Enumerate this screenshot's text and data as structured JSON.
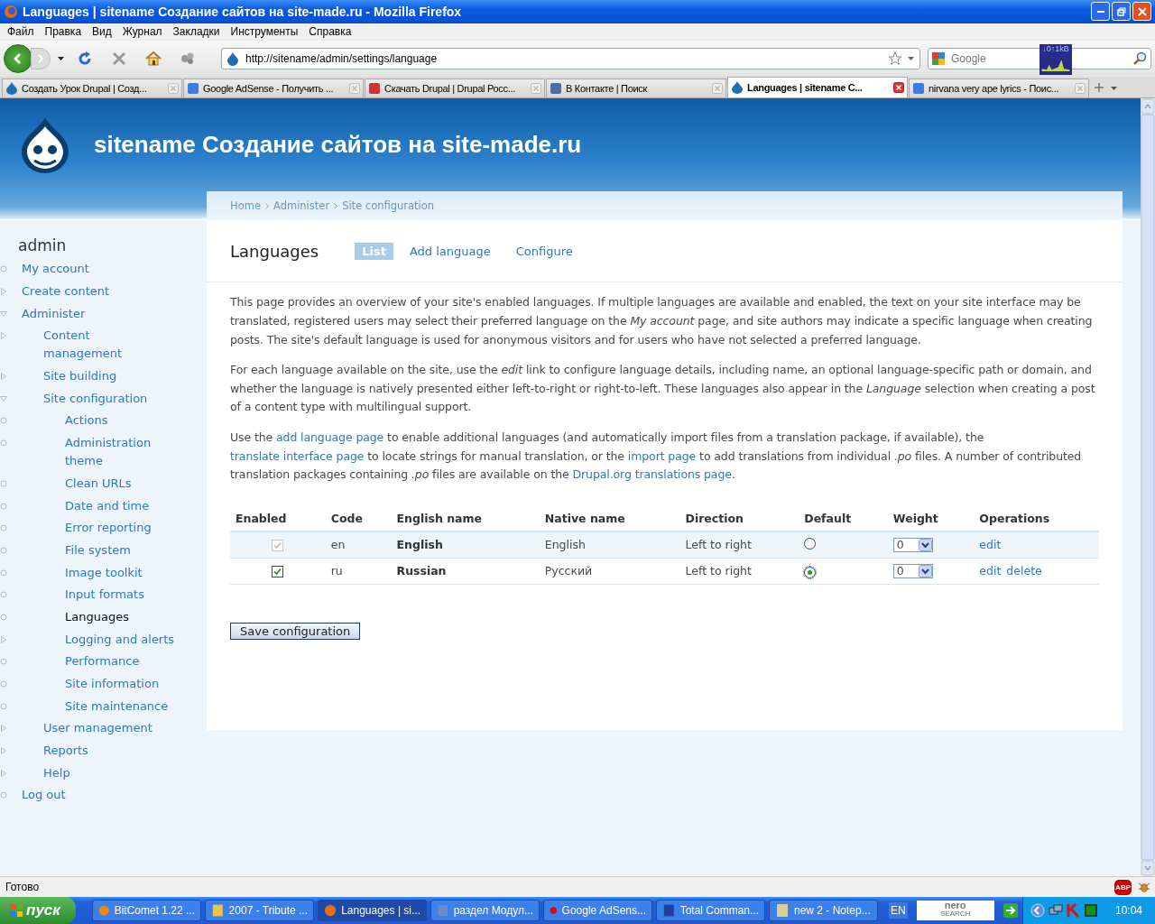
{
  "window": {
    "title": "Languages | sitename Создание сайтов на site-made.ru - Mozilla Firefox"
  },
  "menu": [
    "Файл",
    "Правка",
    "Вид",
    "Журнал",
    "Закладки",
    "Инструменты",
    "Справка"
  ],
  "address": {
    "url": "http://sitename/admin/settings/language"
  },
  "search": {
    "placeholder": "Google"
  },
  "net_meter": {
    "reading": "↓0↑1kB"
  },
  "tabs": [
    {
      "label": "Создать Урок Drupal | Созд...",
      "selected": false
    },
    {
      "label": "Google AdSense - Получить ...",
      "selected": false
    },
    {
      "label": "Скачать Drupal | Drupal Росс...",
      "selected": false
    },
    {
      "label": "В Контакте | Поиск",
      "selected": false
    },
    {
      "label": "Languages | sitename C...",
      "selected": true
    },
    {
      "label": "nirvana very ape lyrics - Поис...",
      "selected": false
    }
  ],
  "site": {
    "name": "sitename Создание сайтов на site-made.ru"
  },
  "sidebar": {
    "title": "admin",
    "items": [
      {
        "label": "My account",
        "kind": "leaf",
        "selected": false
      },
      {
        "label": "Create content",
        "kind": "branch",
        "expanded": false,
        "selected": false
      },
      {
        "label": "Administer",
        "kind": "branch",
        "expanded": true,
        "selected": false,
        "children": [
          {
            "label": "Content management",
            "kind": "branch",
            "expanded": false,
            "selected": false
          },
          {
            "label": "Site building",
            "kind": "branch",
            "expanded": false,
            "selected": false
          },
          {
            "label": "Site configuration",
            "kind": "branch",
            "expanded": true,
            "selected": false,
            "children": [
              {
                "label": "Actions",
                "kind": "leaf",
                "selected": false
              },
              {
                "label": "Administration theme",
                "kind": "leaf",
                "selected": false
              },
              {
                "label": "Clean URLs",
                "kind": "leaf",
                "selected": false
              },
              {
                "label": "Date and time",
                "kind": "leaf",
                "selected": false
              },
              {
                "label": "Error reporting",
                "kind": "leaf",
                "selected": false
              },
              {
                "label": "File system",
                "kind": "leaf",
                "selected": false
              },
              {
                "label": "Image toolkit",
                "kind": "leaf",
                "selected": false
              },
              {
                "label": "Input formats",
                "kind": "leaf",
                "selected": false
              },
              {
                "label": "Languages",
                "kind": "leaf",
                "selected": true
              },
              {
                "label": "Logging and alerts",
                "kind": "branch",
                "expanded": false,
                "selected": false
              },
              {
                "label": "Performance",
                "kind": "leaf",
                "selected": false
              },
              {
                "label": "Site information",
                "kind": "leaf",
                "selected": false
              },
              {
                "label": "Site maintenance",
                "kind": "leaf",
                "selected": false
              }
            ]
          },
          {
            "label": "User management",
            "kind": "branch",
            "expanded": false,
            "selected": false
          },
          {
            "label": "Reports",
            "kind": "branch",
            "expanded": false,
            "selected": false
          },
          {
            "label": "Help",
            "kind": "branch",
            "expanded": false,
            "selected": false
          }
        ]
      },
      {
        "label": "Log out",
        "kind": "leaf",
        "selected": false
      }
    ]
  },
  "breadcrumb": [
    "Home",
    "Administer",
    "Site configuration"
  ],
  "page": {
    "title": "Languages",
    "tabs": [
      {
        "label": "List",
        "selected": true
      },
      {
        "label": "Add language",
        "selected": false
      },
      {
        "label": "Configure",
        "selected": false
      }
    ]
  },
  "paragraphs": [
    [
      {
        "text": "This page provides an overview of your site's enabled languages. If multiple languages are available and enabled, the text on your site interface may be translated, registered users may select their preferred language on the *My account* page, and site authors may indicate a specific language when creating posts. The site's default language is used for anonymous visitors and for users who have not selected a preferred language.",
        "kind": "text"
      }
    ],
    [
      {
        "text": "For each language available on the site, use the *edit* link to configure language details, including name, an optional language-specific path or domain, and whether the language is natively presented either left-to-right or right-to-left. These languages also appear in the *Language* selection when creating a post of a content type with multilingual support.",
        "kind": "text"
      }
    ],
    [
      {
        "text": "Use the ",
        "kind": "text"
      },
      {
        "text": "add language page",
        "kind": "link"
      },
      {
        "text": " to enable additional languages (and automatically import files from a translation package, if available), the ",
        "kind": "text"
      },
      {
        "text": "translate interface page",
        "kind": "link"
      },
      {
        "text": " to locate strings for manual translation, or the ",
        "kind": "text"
      },
      {
        "text": "import page",
        "kind": "link"
      },
      {
        "text": " to add translations from individual *.po* files. A number of contributed translation packages containing *.po* files are available on the ",
        "kind": "text"
      },
      {
        "text": "Drupal.org translations page",
        "kind": "link"
      },
      {
        "text": ".",
        "kind": "text"
      }
    ]
  ],
  "languages": {
    "columns": [
      "Enabled",
      "Code",
      "English name",
      "Native name",
      "Direction",
      "Default",
      "Weight",
      "Operations"
    ],
    "rows": [
      {
        "enabled": true,
        "disabled": true,
        "code": "en",
        "english_name": "English",
        "native_name": "English",
        "direction": "Left to right",
        "default": false,
        "weight": "0",
        "operations": [
          "edit"
        ]
      },
      {
        "enabled": true,
        "disabled": false,
        "code": "ru",
        "english_name": "Russian",
        "native_name": "Русский",
        "direction": "Left to right",
        "default": true,
        "weight": "0",
        "operations": [
          "edit",
          "delete"
        ]
      }
    ]
  },
  "save_button": "Save configuration",
  "status_bar": {
    "text": "Готово",
    "abp": "ABP"
  },
  "taskbar": {
    "start": "пуск",
    "items": [
      {
        "label": "BitComet 1.22 ...",
        "selected": false
      },
      {
        "label": "2007 - Tribute ...",
        "selected": false
      },
      {
        "label": "Languages | si...",
        "selected": true
      },
      {
        "label": "раздел Модул...",
        "selected": false
      },
      {
        "label": "Google AdSens...",
        "selected": false
      },
      {
        "label": "Total Comman...",
        "selected": false
      },
      {
        "label": "new  2 - Notep...",
        "selected": false
      }
    ],
    "language": "EN",
    "search_logo": [
      "nero",
      "SEARCH"
    ],
    "clock": "10:04"
  }
}
